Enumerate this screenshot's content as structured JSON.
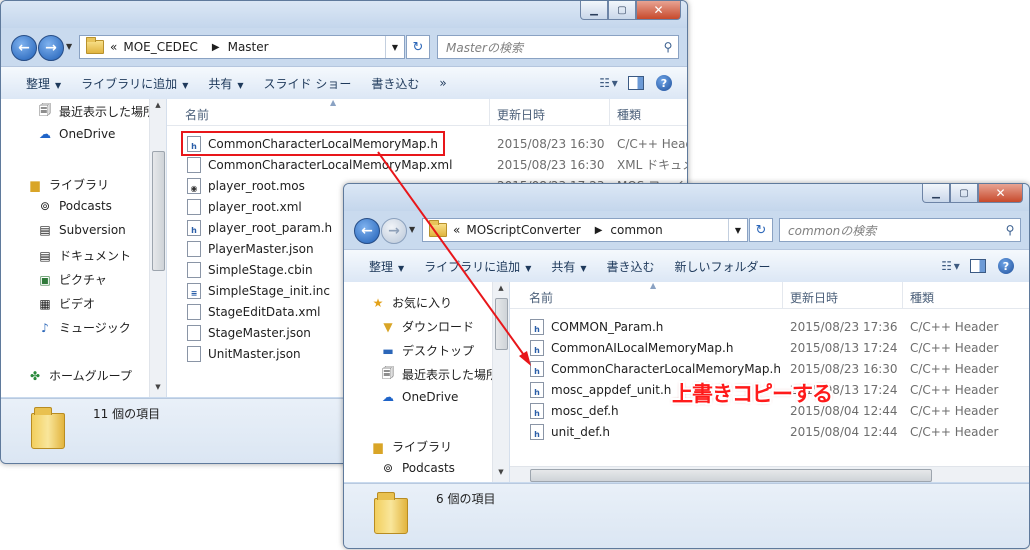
{
  "colors": {
    "accent": "#1f5fb6",
    "highlight": "#e8161a",
    "annotation": "#ff1a1a"
  },
  "window_back": {
    "address": {
      "prefix": "«",
      "crumbs": [
        "MOE_CEDEC",
        "Master"
      ]
    },
    "search_placeholder": "Masterの検索",
    "toolbar": {
      "organize": "整理",
      "add_to_library": "ライブラリに追加",
      "share": "共有",
      "slideshow": "スライド ショー",
      "burn": "書き込む",
      "more": "»"
    },
    "nav": {
      "recent": "最近表示した場所",
      "onedrive": "OneDrive",
      "library": "ライブラリ",
      "podcasts": "Podcasts",
      "subversion": "Subversion",
      "documents": "ドキュメント",
      "pictures": "ピクチャ",
      "videos": "ビデオ",
      "music": "ミュージック",
      "homegroup": "ホームグループ"
    },
    "columns": {
      "name": "名前",
      "date": "更新日時",
      "type": "種類"
    },
    "files": [
      {
        "name": "CommonCharacterLocalMemoryMap.h",
        "date": "2015/08/23 16:30",
        "type": "C/C++ Header",
        "icon": "h-file-icon"
      },
      {
        "name": "CommonCharacterLocalMemoryMap.xml",
        "date": "2015/08/23 16:30",
        "type": "XML ドキュメント",
        "icon": "xml-file-icon"
      },
      {
        "name": "player_root.mos",
        "date": "2015/08/23 17:23",
        "type": "MOS ファイル",
        "icon": "mos-file-icon"
      },
      {
        "name": "player_root.xml",
        "date": "",
        "type": "",
        "icon": "xml-file-icon"
      },
      {
        "name": "player_root_param.h",
        "date": "",
        "type": "",
        "icon": "h-file-icon"
      },
      {
        "name": "PlayerMaster.json",
        "date": "",
        "type": "",
        "icon": "json-file-icon"
      },
      {
        "name": "SimpleStage.cbin",
        "date": "",
        "type": "",
        "icon": "file-icon"
      },
      {
        "name": "SimpleStage_init.inc",
        "date": "",
        "type": "",
        "icon": "inc-file-icon"
      },
      {
        "name": "StageEditData.xml",
        "date": "",
        "type": "",
        "icon": "xml-file-icon"
      },
      {
        "name": "StageMaster.json",
        "date": "",
        "type": "",
        "icon": "json-file-icon"
      },
      {
        "name": "UnitMaster.json",
        "date": "",
        "type": "",
        "icon": "json-file-icon"
      }
    ],
    "status": "11 個の項目"
  },
  "window_front": {
    "address": {
      "prefix": "«",
      "crumbs": [
        "MOScriptConverter",
        "common"
      ]
    },
    "search_placeholder": "commonの検索",
    "toolbar": {
      "organize": "整理",
      "add_to_library": "ライブラリに追加",
      "share": "共有",
      "burn": "書き込む",
      "new_folder": "新しいフォルダー"
    },
    "nav": {
      "favorites": "お気に入り",
      "downloads": "ダウンロード",
      "desktop": "デスクトップ",
      "recent": "最近表示した場所",
      "onedrive": "OneDrive",
      "library": "ライブラリ",
      "podcasts": "Podcasts"
    },
    "columns": {
      "name": "名前",
      "date": "更新日時",
      "type": "種類"
    },
    "files": [
      {
        "name": "COMMON_Param.h",
        "date": "2015/08/23 17:36",
        "type": "C/C++ Header"
      },
      {
        "name": "CommonAILocalMemoryMap.h",
        "date": "2015/08/13 17:24",
        "type": "C/C++ Header"
      },
      {
        "name": "CommonCharacterLocalMemoryMap.h",
        "date": "2015/08/23 16:30",
        "type": "C/C++ Header"
      },
      {
        "name": "mosc_appdef_unit.h",
        "date": "2015/08/13 17:24",
        "type": "C/C++ Header"
      },
      {
        "name": "mosc_def.h",
        "date": "2015/08/04 12:44",
        "type": "C/C++ Header"
      },
      {
        "name": "unit_def.h",
        "date": "2015/08/04 12:44",
        "type": "C/C++ Header"
      }
    ],
    "status": "6 個の項目"
  },
  "annotation": {
    "text": "上書きコピーする"
  }
}
